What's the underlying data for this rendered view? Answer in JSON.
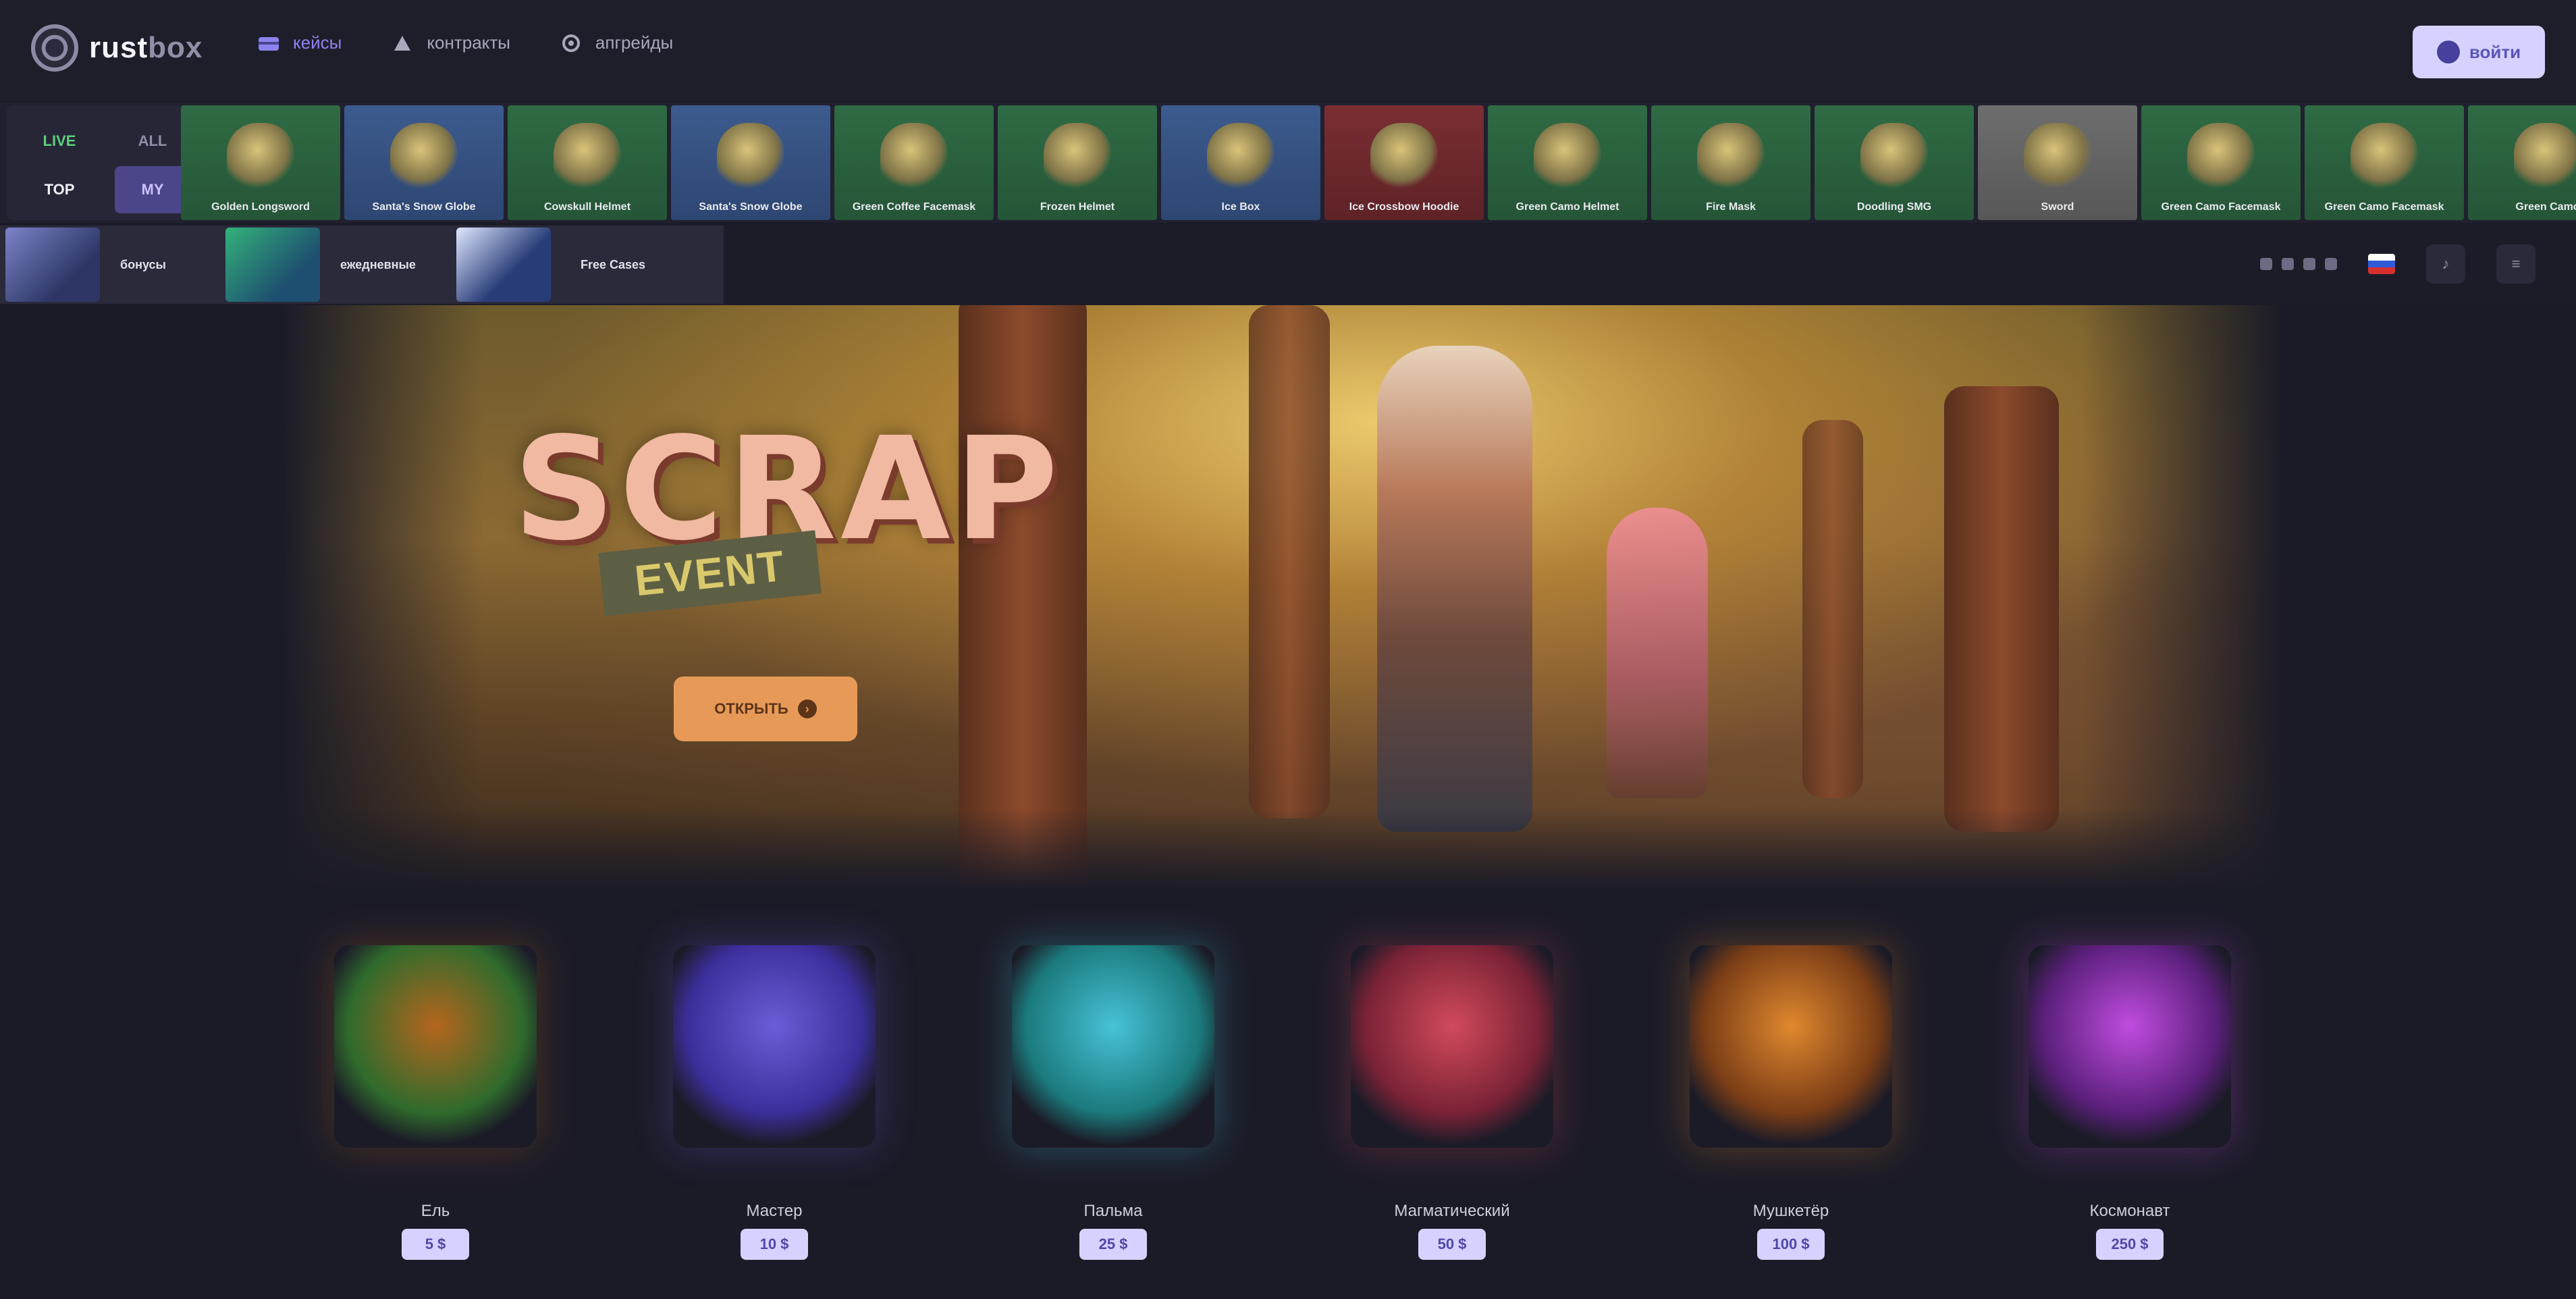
{
  "nav": {
    "logo_a": "rust",
    "logo_b": "box",
    "links": [
      {
        "label": "кейсы",
        "icon": "cases-icon",
        "active": true
      },
      {
        "label": "контракты",
        "icon": "contract-icon",
        "active": false
      },
      {
        "label": "апгрейды",
        "icon": "upgrade-icon",
        "active": false
      }
    ],
    "login_label": "войти",
    "accent": "#8d83f0"
  },
  "drops": {
    "filters": [
      "LIVE",
      "TOP",
      "ALL",
      "MY"
    ],
    "items": [
      {
        "name": "Golden Longsword",
        "rarity": "green"
      },
      {
        "name": "Santa's Snow Globe",
        "rarity": "blue"
      },
      {
        "name": "Cowskull Helmet",
        "rarity": "green"
      },
      {
        "name": "Santa's Snow Globe",
        "rarity": "blue"
      },
      {
        "name": "Green Coffee Facemask",
        "rarity": "green"
      },
      {
        "name": "Frozen Helmet",
        "rarity": "green"
      },
      {
        "name": "Ice Box",
        "rarity": "blue"
      },
      {
        "name": "Ice Crossbow Hoodie",
        "rarity": "red"
      },
      {
        "name": "Green Camo Helmet",
        "rarity": "green"
      },
      {
        "name": "Fire Mask",
        "rarity": "green"
      },
      {
        "name": "Doodling SMG",
        "rarity": "green"
      },
      {
        "name": "Sword",
        "rarity": "grey"
      },
      {
        "name": "Green Camo Facemask",
        "rarity": "green"
      },
      {
        "name": "Green Camo Facemask",
        "rarity": "green"
      },
      {
        "name": "Green Camo",
        "rarity": "green"
      }
    ]
  },
  "subbar": {
    "promos": [
      {
        "label": "бонусы"
      },
      {
        "label": "ежедневные"
      },
      {
        "label": "Free Cases"
      }
    ]
  },
  "hero": {
    "title": "SCRAP",
    "subtitle": "EVENT",
    "button_label": "ОТКРЫТЬ"
  },
  "cases": [
    {
      "name": "Ель",
      "price": "5 $",
      "colors": [
        "#2f6b2c",
        "#b5651d"
      ]
    },
    {
      "name": "Мастер",
      "price": "10 $",
      "colors": [
        "#3a2f9a",
        "#6a5dd8"
      ]
    },
    {
      "name": "Пальма",
      "price": "25 $",
      "colors": [
        "#1b7a7c",
        "#47c2d8"
      ]
    },
    {
      "name": "Магматический",
      "price": "50 $",
      "colors": [
        "#7a2236",
        "#d14a5a"
      ]
    },
    {
      "name": "Мушкетёр",
      "price": "100 $",
      "colors": [
        "#7a3d16",
        "#e0882e"
      ]
    },
    {
      "name": "Космонавт",
      "price": "250 $",
      "colors": [
        "#5a1f7a",
        "#c04ce0"
      ]
    }
  ]
}
